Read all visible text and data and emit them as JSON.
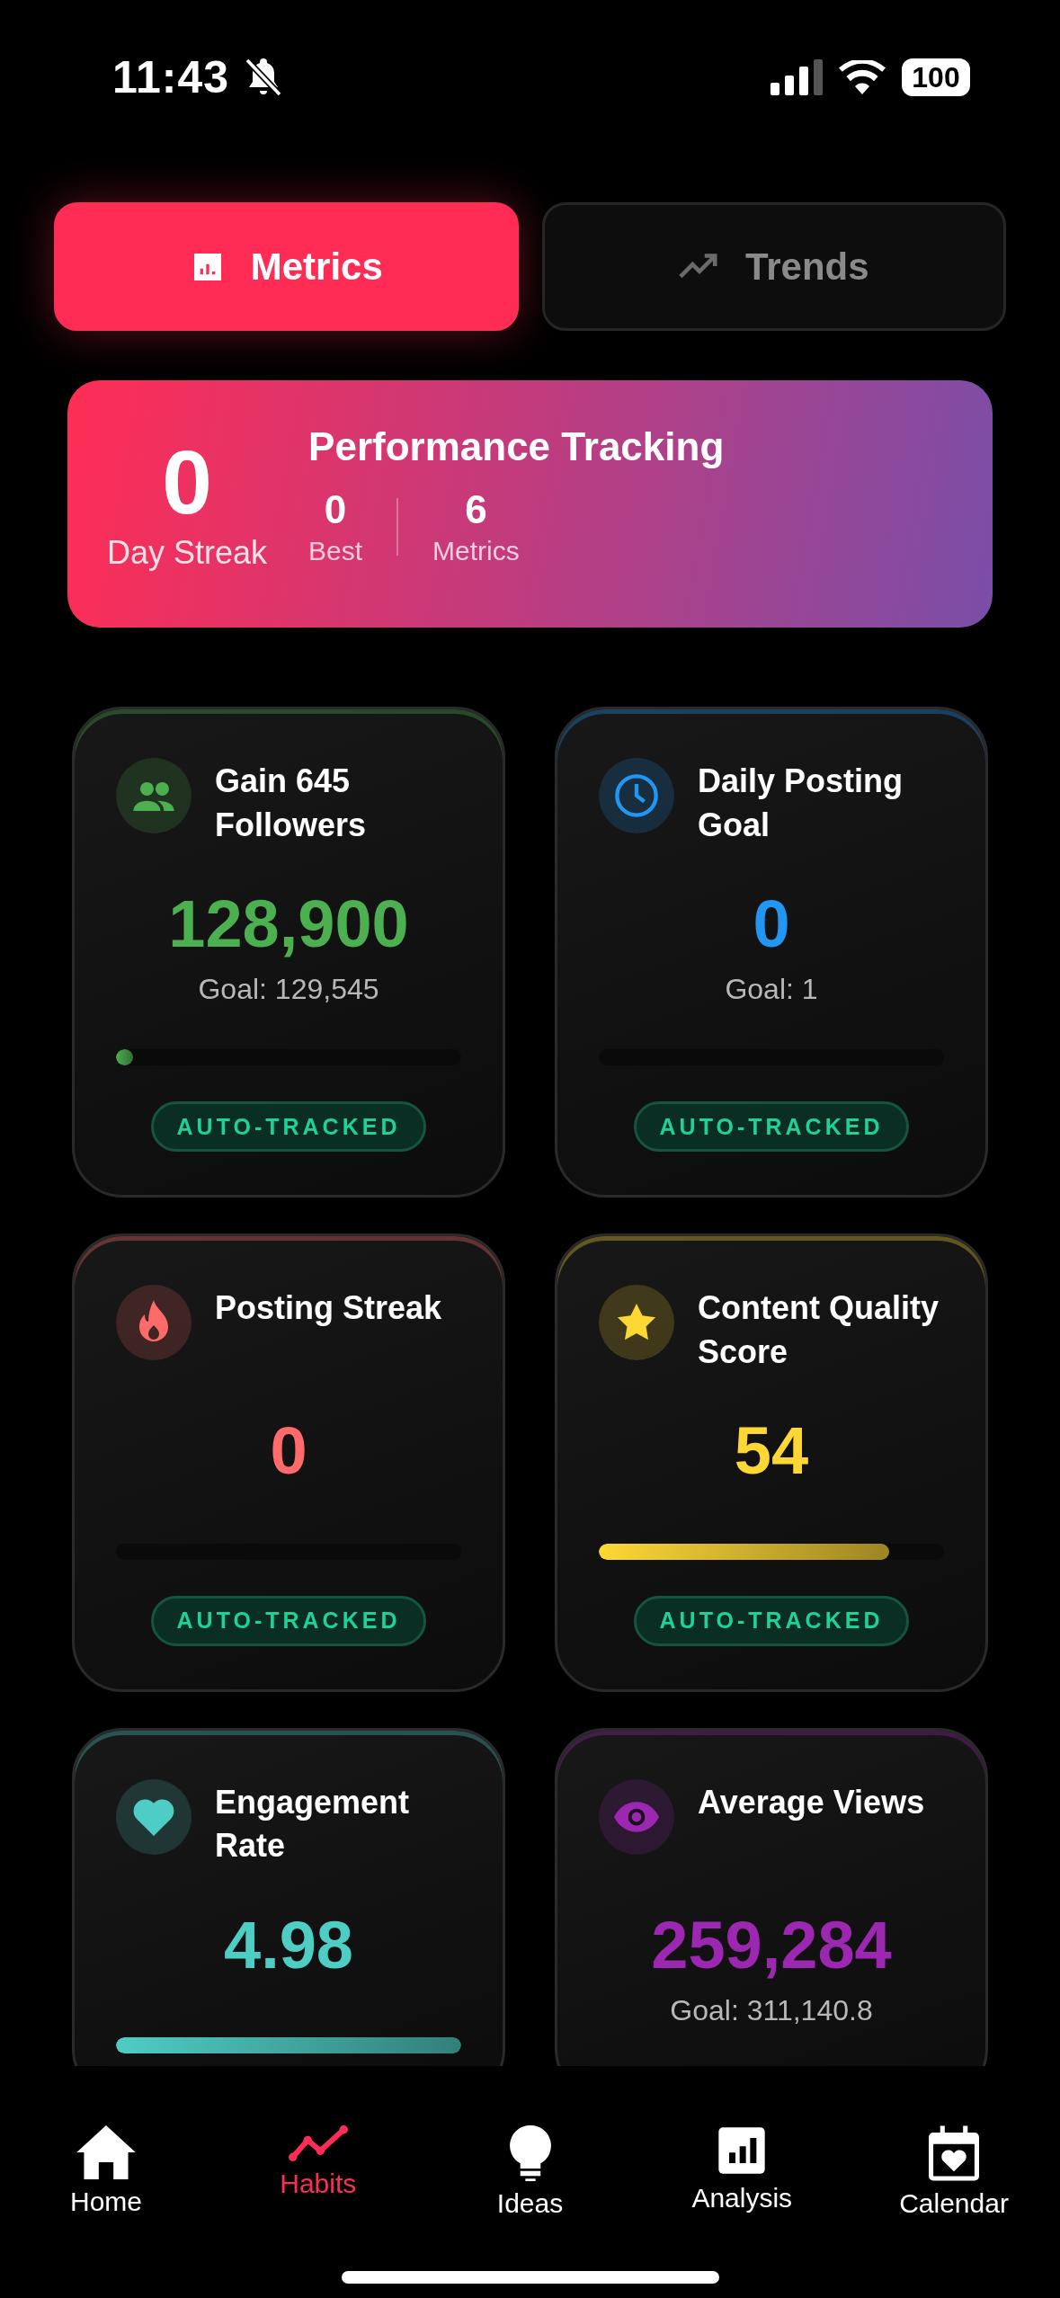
{
  "status_bar": {
    "time": "11:43",
    "battery": "100"
  },
  "tabs": [
    {
      "label": "Metrics",
      "selected": true
    },
    {
      "label": "Trends",
      "selected": false
    }
  ],
  "streak_banner": {
    "streak": "0",
    "streak_label": "Day Streak",
    "title": "Performance Tracking",
    "stats": [
      {
        "value": "0",
        "label": "Best"
      },
      {
        "value": "6",
        "label": "Metrics"
      }
    ]
  },
  "metrics": [
    {
      "title": "Gain 645 Followers",
      "value": "128,900",
      "goal": "Goal: 129,545",
      "level": 0.05,
      "color": "#4caf50",
      "badge": "AUTO-TRACKED"
    },
    {
      "title": "Daily Posting Goal",
      "value": "0",
      "goal": "Goal: 1",
      "level": 0,
      "color": "#2196f3",
      "badge": "AUTO-TRACKED"
    },
    {
      "title": "Posting Streak",
      "value": "0",
      "level": 0,
      "color": "#ff6b6b",
      "badge": "AUTO-TRACKED"
    },
    {
      "title": "Content Quality Score",
      "value": "54",
      "level": 0.84,
      "color": "#fdd835",
      "badge": "AUTO-TRACKED"
    },
    {
      "title": "Engagement Rate",
      "value": "4.98",
      "level": 1,
      "color": "#4ecdc4"
    },
    {
      "title": "Average Views",
      "value": "259,284",
      "goal": "Goal: 311,140.8",
      "color": "#9c27b0"
    }
  ],
  "bottom_nav": [
    {
      "label": "Home",
      "selected": false
    },
    {
      "label": "Habits",
      "selected": true
    },
    {
      "label": "Ideas",
      "selected": false
    },
    {
      "label": "Analysis",
      "selected": false
    },
    {
      "label": "Calendar",
      "selected": false
    }
  ]
}
